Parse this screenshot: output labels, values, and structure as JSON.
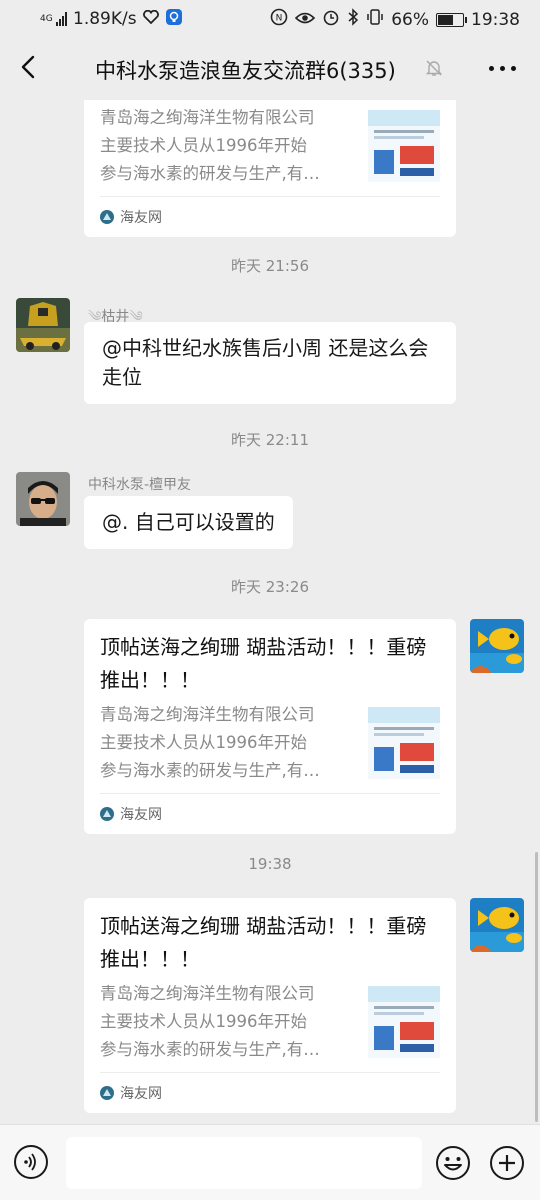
{
  "status_bar": {
    "network_type": "4G",
    "speed": "1.89K/s",
    "battery": "66%",
    "battery_level": 0.66,
    "time": "19:38",
    "icons": [
      "signal-icon",
      "heart-icon",
      "notification-icon",
      "nfc-icon",
      "eye-icon",
      "alarm-icon",
      "bluetooth-icon",
      "vibrate-icon",
      "battery-icon"
    ]
  },
  "header": {
    "title": "中科水泵造浪鱼友交流群6(335)",
    "back_icon": "back-arrow-icon",
    "mute_icon": "bell-muted-icon",
    "more_icon": "more-dots-icon"
  },
  "messages": {
    "top_card": {
      "lines": [
        "青岛海之绚海洋生物有限公司",
        "主要技术人员从1996年开始",
        "参与海水素的研发与生产,有…"
      ],
      "source": "海友网"
    },
    "ts1": "昨天 21:56",
    "msg1": {
      "sender": "枯井",
      "text": "@中科世纪水族售后小周  还是这么会走位"
    },
    "ts2": "昨天 22:11",
    "msg2": {
      "sender": "中科水泵-檀甲友",
      "text": "@. 自己可以设置的"
    },
    "ts3": "昨天 23:26",
    "card1": {
      "title": "顶帖送海之绚珊 瑚盐活动！！！重磅推出！！！",
      "lines": [
        "青岛海之绚海洋生物有限公司",
        "主要技术人员从1996年开始",
        "参与海水素的研发与生产,有…"
      ],
      "source": "海友网"
    },
    "ts4": "19:38",
    "card2": {
      "title": "顶帖送海之绚珊 瑚盐活动！！！重磅推出！！！",
      "lines": [
        "青岛海之绚海洋生物有限公司",
        "主要技术人员从1996年开始",
        "参与海水素的研发与生产,有…"
      ],
      "source": "海友网"
    }
  },
  "input_bar": {
    "voice_icon": "voice-icon",
    "text_value": "",
    "emoji_icon": "emoji-icon",
    "plus_icon": "plus-icon"
  },
  "colors": {
    "chat_background": "#ededed",
    "bubble": "#ffffff",
    "timestamp": "#8a8a8a"
  }
}
